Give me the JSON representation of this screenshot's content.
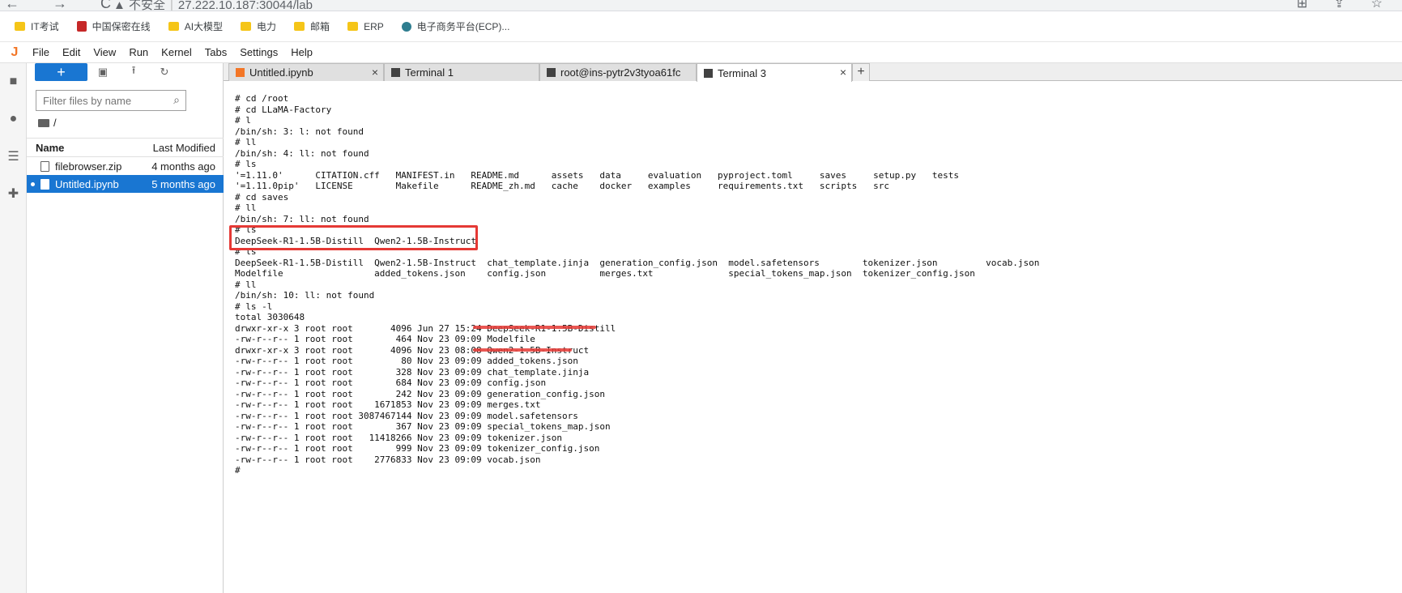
{
  "browser": {
    "nav_icons": "← → C",
    "security": "▲ 不安全",
    "url": "27.222.10.187:30044/lab",
    "right_icons": "⊞ ⇪ ☆"
  },
  "bookmarks": [
    {
      "label": "IT考试",
      "icon": "folder-icon"
    },
    {
      "label": "中国保密在线",
      "icon": "shield-icon"
    },
    {
      "label": "AI大模型",
      "icon": "folder-icon"
    },
    {
      "label": "电力",
      "icon": "folder-icon"
    },
    {
      "label": "邮箱",
      "icon": "folder-icon"
    },
    {
      "label": "ERP",
      "icon": "folder-icon"
    },
    {
      "label": "电子商务平台(ECP)...",
      "icon": "globe-icon"
    }
  ],
  "menubar": {
    "logo": "J",
    "items": [
      "File",
      "Edit",
      "View",
      "Run",
      "Kernel",
      "Tabs",
      "Settings",
      "Help"
    ]
  },
  "activity_icons": {
    "files": "■",
    "running": "●",
    "toc": "☰",
    "extensions": "✚"
  },
  "filebrowser": {
    "new_label": "+",
    "new_folder": "▣",
    "upload": "⭱",
    "refresh": "↻",
    "search_placeholder": "Filter files by name",
    "search_icon": "⌕",
    "path": "/",
    "col_name": "Name",
    "col_modified": "Last Modified",
    "files": [
      {
        "name": "filebrowser.zip",
        "modified": "4 months ago"
      },
      {
        "name": "Untitled.ipynb",
        "modified": "5 months ago"
      }
    ]
  },
  "tabs": [
    {
      "label": "Untitled.ipynb",
      "type": "notebook"
    },
    {
      "label": "Terminal 1",
      "type": "terminal"
    },
    {
      "label": "root@ins-pytr2v3tyoa61fc",
      "type": "terminal"
    },
    {
      "label": "Terminal 3",
      "type": "terminal"
    }
  ],
  "tab_close": "×",
  "tab_add": "+",
  "terminal_lines": [
    "# cd /root",
    "# cd LLaMA-Factory",
    "# l",
    "/bin/sh: 3: l: not found",
    "# ll",
    "/bin/sh: 4: ll: not found",
    "# ls",
    "'=1.11.0'      CITATION.cff   MANIFEST.in   README.md      assets   data     evaluation   pyproject.toml     saves     setup.py   tests",
    "'=1.11.0pip'   LICENSE        Makefile      README_zh.md   cache    docker   examples     requirements.txt   scripts   src",
    "# cd saves",
    "# ll",
    "/bin/sh: 7: ll: not found",
    "# ls",
    "DeepSeek-R1-1.5B-Distill  Qwen2-1.5B-Instruct",
    "# ls",
    "DeepSeek-R1-1.5B-Distill  Qwen2-1.5B-Instruct  chat_template.jinja  generation_config.json  model.safetensors        tokenizer.json         vocab.json",
    "Modelfile                 added_tokens.json    config.json          merges.txt              special_tokens_map.json  tokenizer_config.json",
    "# ll",
    "/bin/sh: 10: ll: not found",
    "# ls -l",
    "total 3030648",
    "drwxr-xr-x 3 root root       4096 Jun 27 15:24 DeepSeek-R1-1.5B-Distill",
    "-rw-r--r-- 1 root root        464 Nov 23 09:09 Modelfile",
    "drwxr-xr-x 3 root root       4096 Nov 23 08:08 Qwen2-1.5B-Instruct",
    "-rw-r--r-- 1 root root         80 Nov 23 09:09 added_tokens.json",
    "-rw-r--r-- 1 root root        328 Nov 23 09:09 chat_template.jinja",
    "-rw-r--r-- 1 root root        684 Nov 23 09:09 config.json",
    "-rw-r--r-- 1 root root        242 Nov 23 09:09 generation_config.json",
    "-rw-r--r-- 1 root root    1671853 Nov 23 09:09 merges.txt",
    "-rw-r--r-- 1 root root 3087467144 Nov 23 09:09 model.safetensors",
    "-rw-r--r-- 1 root root        367 Nov 23 09:09 special_tokens_map.json",
    "-rw-r--r-- 1 root root   11418266 Nov 23 09:09 tokenizer.json",
    "-rw-r--r-- 1 root root        999 Nov 23 09:09 tokenizer_config.json",
    "-rw-r--r-- 1 root root    2776833 Nov 23 09:09 vocab.json",
    "#"
  ],
  "colors": {
    "accent": "#1976d2",
    "highlight": "#e53935",
    "jupyter_orange": "#f37626"
  }
}
